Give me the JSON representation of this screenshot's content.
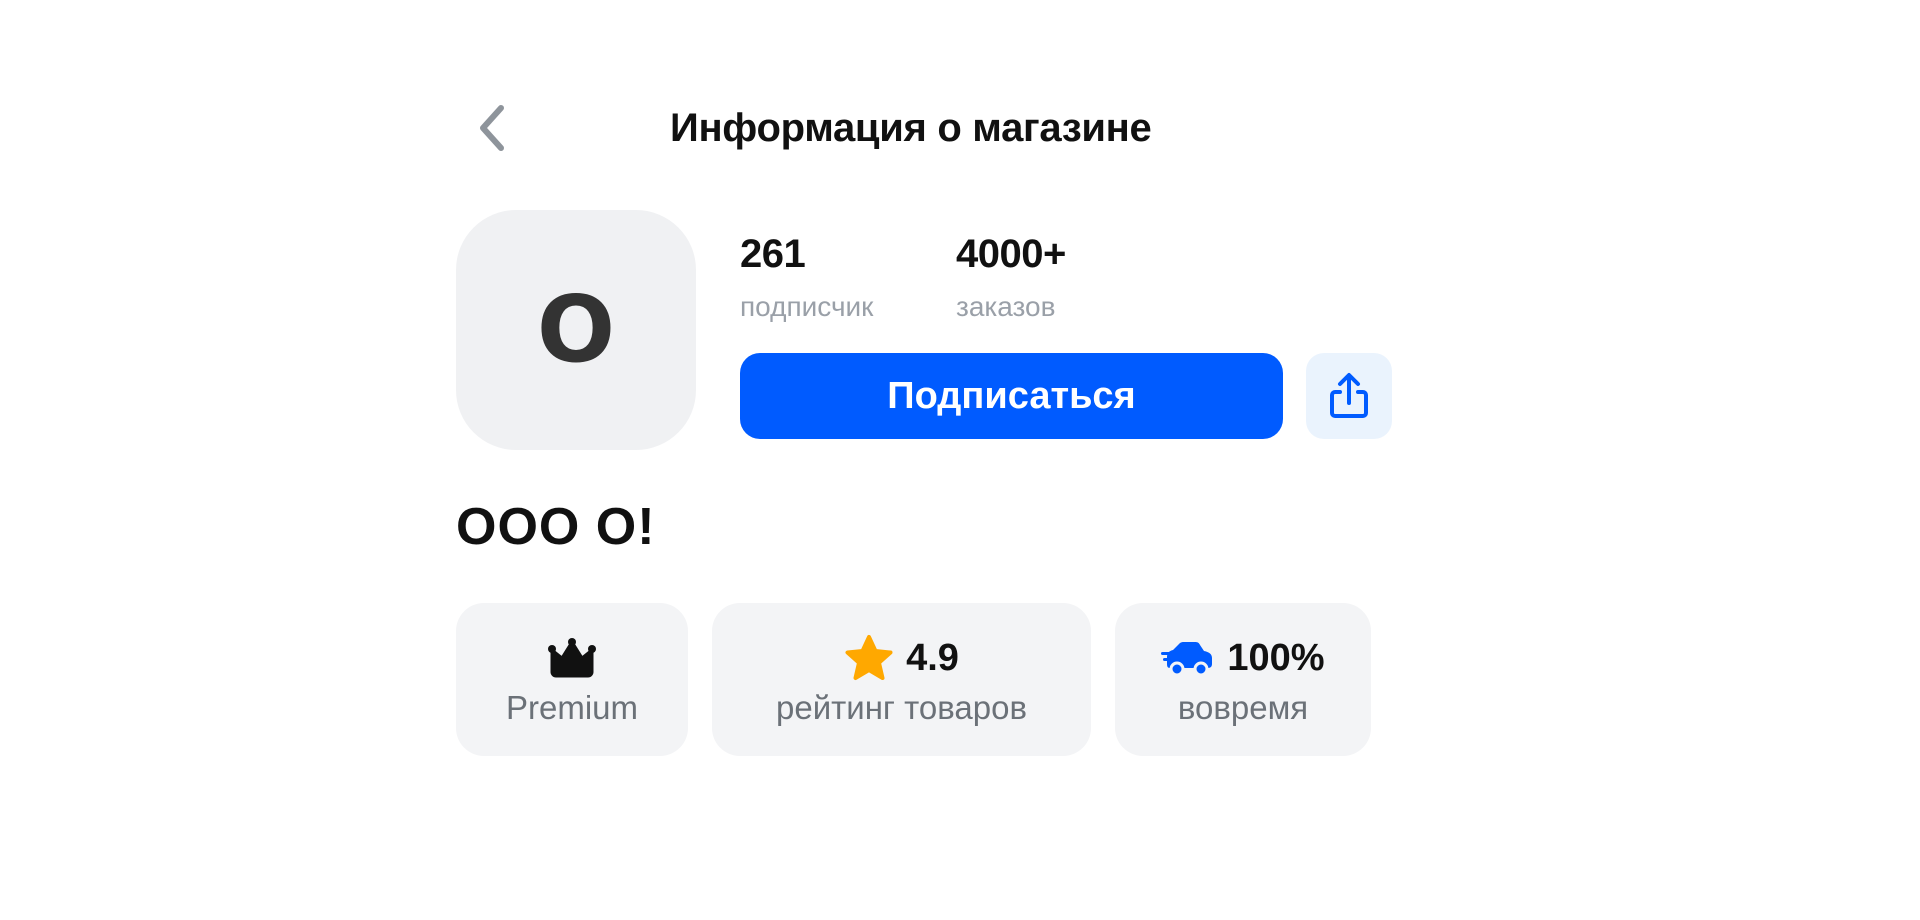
{
  "header": {
    "back_icon": "chevron-left-icon",
    "title": "Информация о магазине"
  },
  "shop": {
    "avatar_letter": "O",
    "name": "ООО О!"
  },
  "stats": {
    "subscribers": {
      "value": "261",
      "label": "подписчик"
    },
    "orders": {
      "value": "4000+",
      "label": "заказов"
    }
  },
  "actions": {
    "subscribe_label": "Подписаться",
    "share_icon": "share-icon"
  },
  "badges": {
    "premium": {
      "icon": "crown-icon",
      "label": "Premium"
    },
    "rating": {
      "icon": "star-icon",
      "value": "4.9",
      "label": "рейтинг товаров"
    },
    "on_time": {
      "icon": "delivery-car-icon",
      "value": "100%",
      "label": "вовремя"
    }
  },
  "colors": {
    "accent": "#005bff",
    "share_bg": "#eaf3fd",
    "badge_bg": "#f3f4f6",
    "avatar_bg": "#f0f1f3",
    "star": "#ffa800",
    "muted_text": "#9aa0a8"
  }
}
